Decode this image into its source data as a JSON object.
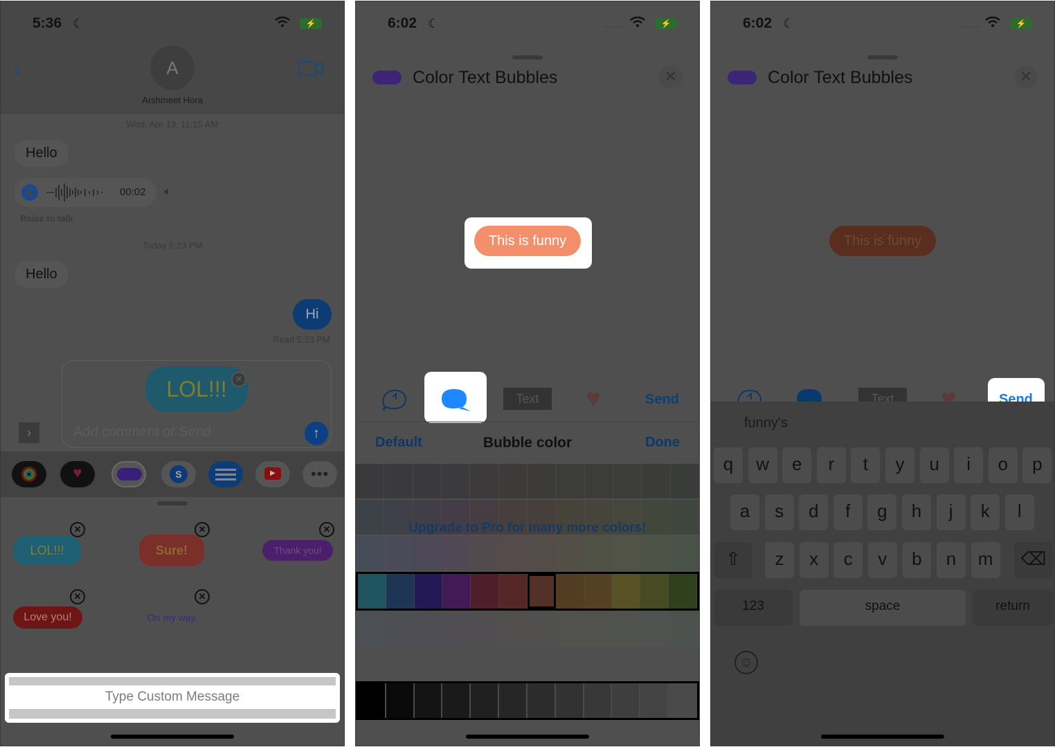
{
  "panel1": {
    "status_time": "5:36",
    "contact_initial": "A",
    "contact_name": "Arshmeet Hora",
    "timestamp1": "Wed, Apr 13, 11:15 AM",
    "msg_hello1": "Hello",
    "audio_duration": "00:02",
    "raise_to_talk": "Raise to talk",
    "timestamp2": "Today 5:23 PM",
    "msg_hello2": "Hello",
    "msg_hi": "Hi",
    "read_receipt": "Read 5:23 PM",
    "compose_sticker": "LOL!!!",
    "compose_placeholder": "Add comment or Send",
    "stickers": [
      {
        "text": "LOL!!!",
        "bg": "#1e5f73",
        "fg": "#8a7a30"
      },
      {
        "text": "Sure!",
        "bg": "#7a3028",
        "fg": "#8a6a30"
      },
      {
        "text": "Thank you!",
        "bg": "#4b1f6b",
        "fg": "#6a4f80"
      },
      {
        "text": "Love you!",
        "bg": "#6e1616",
        "fg": "#b08080"
      },
      {
        "text": "On my way.",
        "bg": "#4f4f4f",
        "fg": "#3b2a7a"
      }
    ],
    "custom_message_placeholder": "Type Custom Message"
  },
  "panel2": {
    "status_time": "6:02",
    "sheet_title": "Color Text Bubbles",
    "preview_text": "This is funny",
    "preview_bg": "#f3906b",
    "toolbar": {
      "text_label": "Text",
      "send_label": "Send"
    },
    "picker": {
      "default_label": "Default",
      "title": "Bubble color",
      "done_label": "Done",
      "upgrade_text": "Upgrade to Pro for many more colors!",
      "selected_index": 6,
      "accent_row": [
        "#1e5560",
        "#1f3556",
        "#231a55",
        "#431a55",
        "#4e1f2a",
        "#562727",
        "#533127",
        "#523c22",
        "#544022",
        "#565226",
        "#464b22",
        "#30401f"
      ],
      "gray_row": [
        "#000000",
        "#0a0a0a",
        "#141414",
        "#1a1a1a",
        "#202020",
        "#262626",
        "#2c2c2c",
        "#323232",
        "#383838",
        "#3e3e3e",
        "#444444",
        "#4a4a4a"
      ]
    }
  },
  "panel3": {
    "status_time": "6:02",
    "sheet_title": "Color Text Bubbles",
    "preview_text": "This is funny",
    "preview_bg": "#5a2e1e",
    "toolbar": {
      "text_label": "Text",
      "send_label": "Send"
    },
    "keyboard": {
      "suggestion": "funny's",
      "row1": [
        "q",
        "w",
        "e",
        "r",
        "t",
        "y",
        "u",
        "i",
        "o",
        "p"
      ],
      "row2": [
        "a",
        "s",
        "d",
        "f",
        "g",
        "h",
        "j",
        "k",
        "l"
      ],
      "row3": [
        "z",
        "x",
        "c",
        "v",
        "b",
        "n",
        "m"
      ],
      "numbers_label": "123",
      "space_label": "space",
      "return_label": "return"
    }
  }
}
